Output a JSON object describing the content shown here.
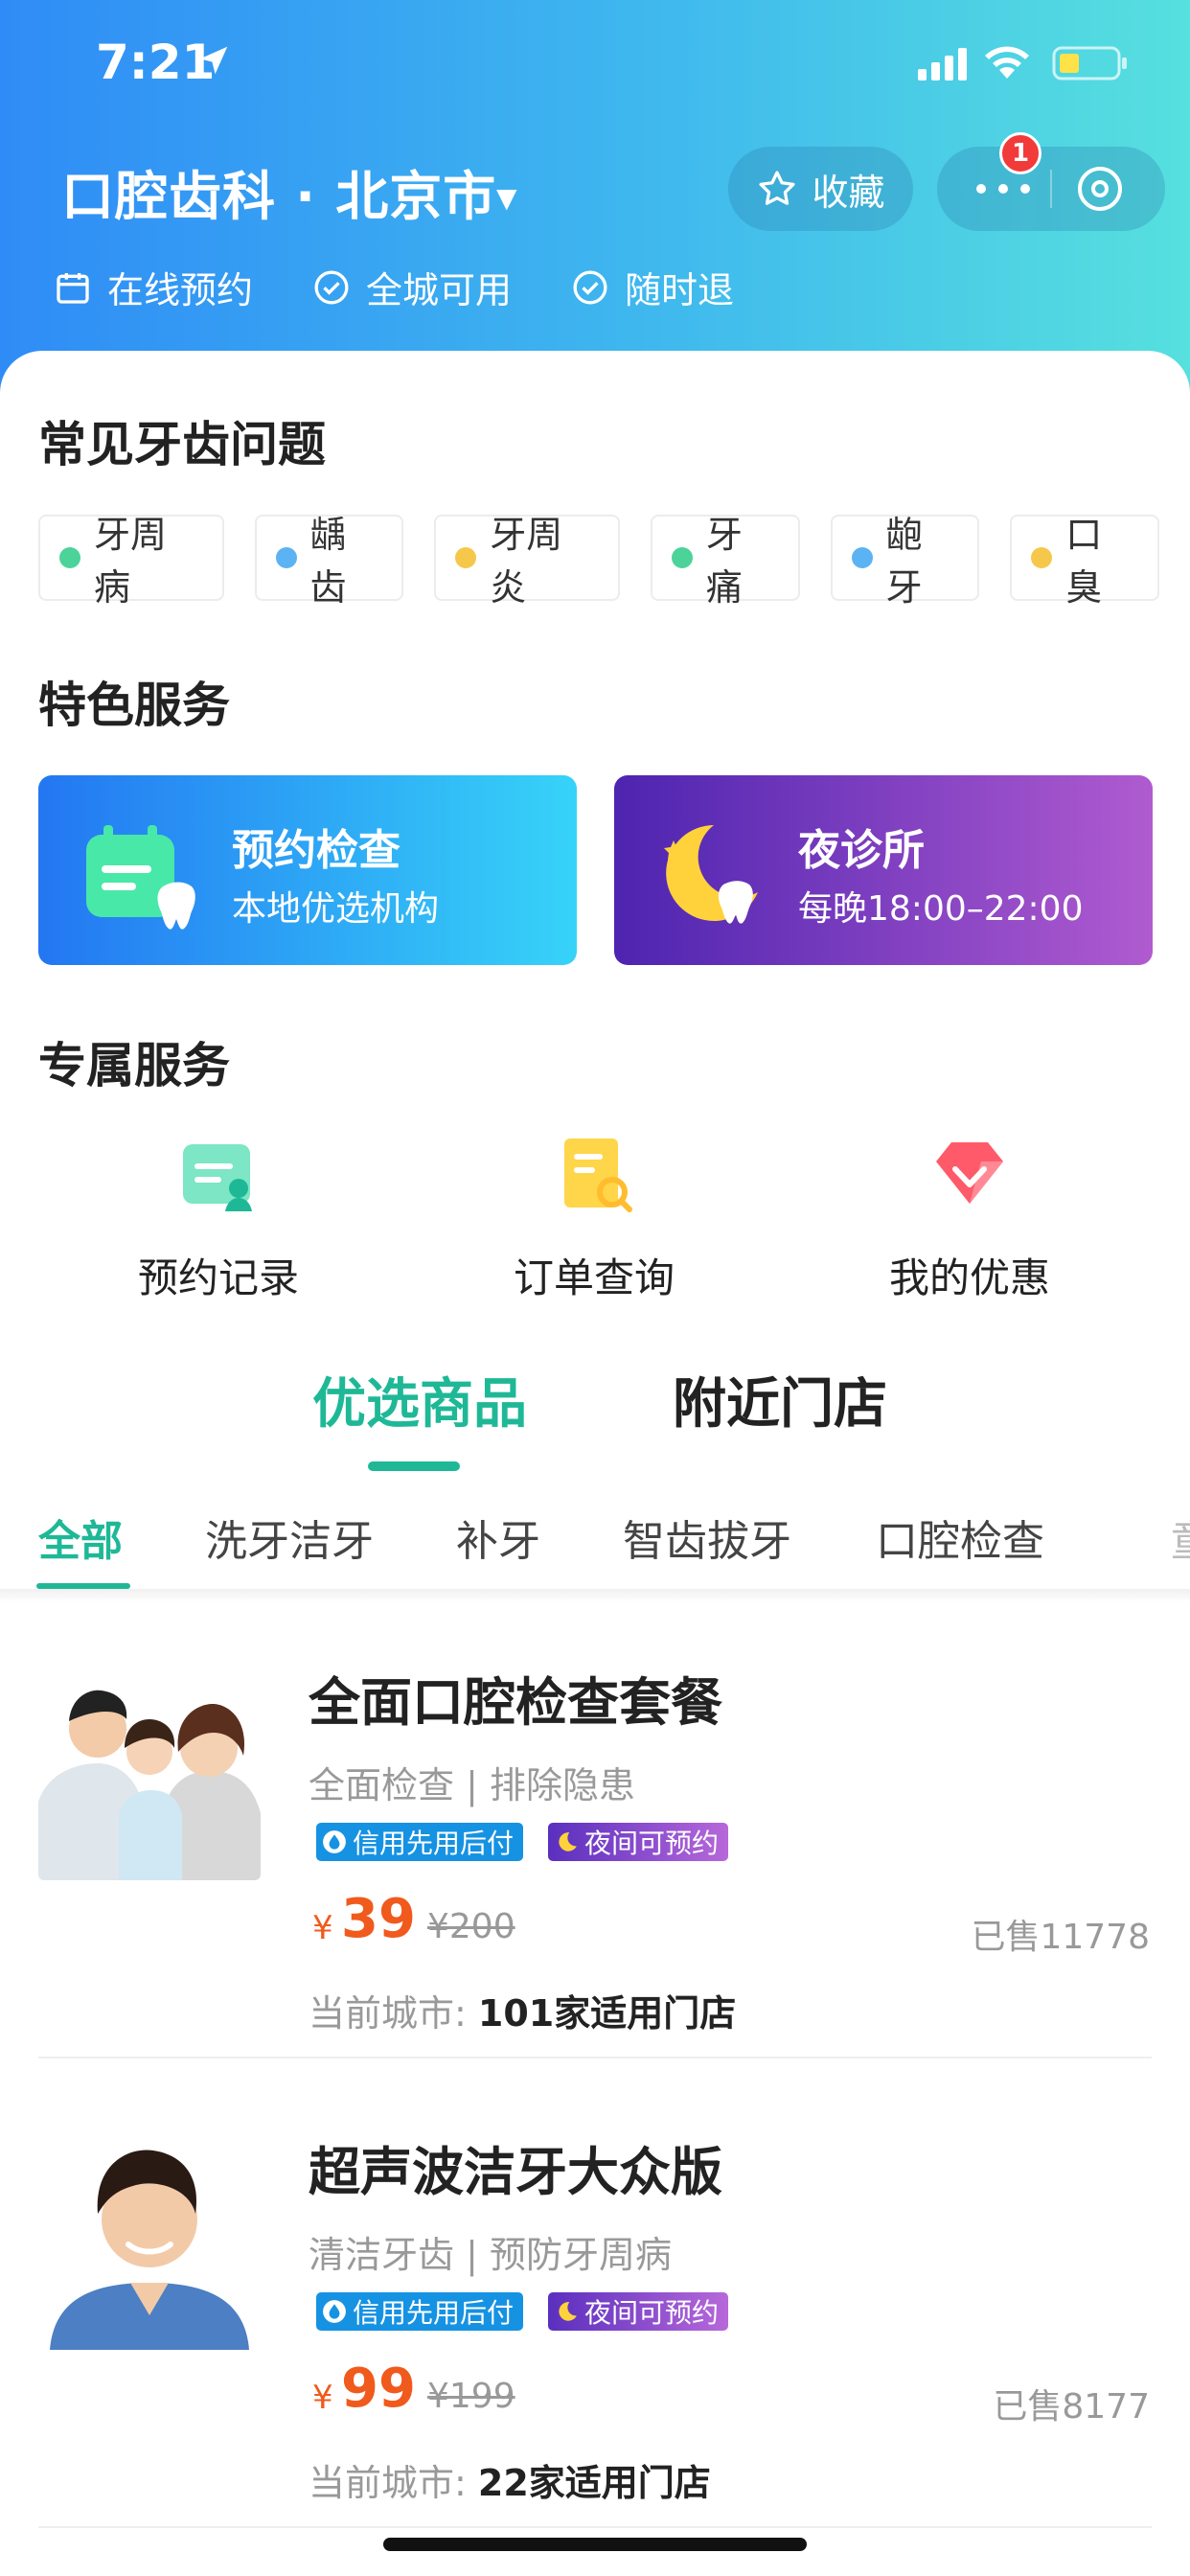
{
  "status_bar": {
    "time": "7:21"
  },
  "header": {
    "title": "口腔齿科 · 北京市",
    "favorite_label": "收藏",
    "notification_count": "1",
    "features": [
      "在线预约",
      "全城可用",
      "随时退"
    ]
  },
  "common_problems": {
    "heading": "常见牙齿问题",
    "items": [
      {
        "label": "牙周病",
        "dot_color": "#4cd39a"
      },
      {
        "label": "龋齿",
        "dot_color": "#5cb3f3"
      },
      {
        "label": "牙周炎",
        "dot_color": "#f5c84b"
      },
      {
        "label": "牙痛",
        "dot_color": "#4cd39a"
      },
      {
        "label": "龅牙",
        "dot_color": "#5cb3f3"
      },
      {
        "label": "口臭",
        "dot_color": "#f5c84b"
      }
    ]
  },
  "featured": {
    "heading": "特色服务",
    "cards": [
      {
        "title": "预约检查",
        "subtitle": "本地优选机构"
      },
      {
        "title": "夜诊所",
        "subtitle": "每晚18:00–22:00"
      }
    ]
  },
  "exclusive": {
    "heading": "专属服务",
    "items": [
      "预约记录",
      "订单查询",
      "我的优惠"
    ]
  },
  "main_tabs": [
    "优选商品",
    "附近门店"
  ],
  "categories": [
    "全部",
    "洗牙洁牙",
    "补牙",
    "智齿拔牙",
    "口腔检查",
    "童"
  ],
  "products": [
    {
      "name": "全面口腔检查套餐",
      "desc": "全面检查 | 排除隐患",
      "tags": [
        "信用先用后付",
        "夜间可预约"
      ],
      "currency": "¥",
      "price": "39",
      "original_price": "¥200",
      "sold": "已售11778",
      "city_label": "当前城市:",
      "city_value": "101家适用门店"
    },
    {
      "name": "超声波洁牙大众版",
      "desc": "清洁牙齿 | 预防牙周病",
      "tags": [
        "信用先用后付",
        "夜间可预约"
      ],
      "currency": "¥",
      "price": "99",
      "original_price": "¥199",
      "sold": "已售8177",
      "city_label": "当前城市:",
      "city_value": "22家适用门店"
    }
  ],
  "colors": {
    "accent": "#1fb897",
    "price": "#f05a1c",
    "badge": "#f23a3a"
  }
}
